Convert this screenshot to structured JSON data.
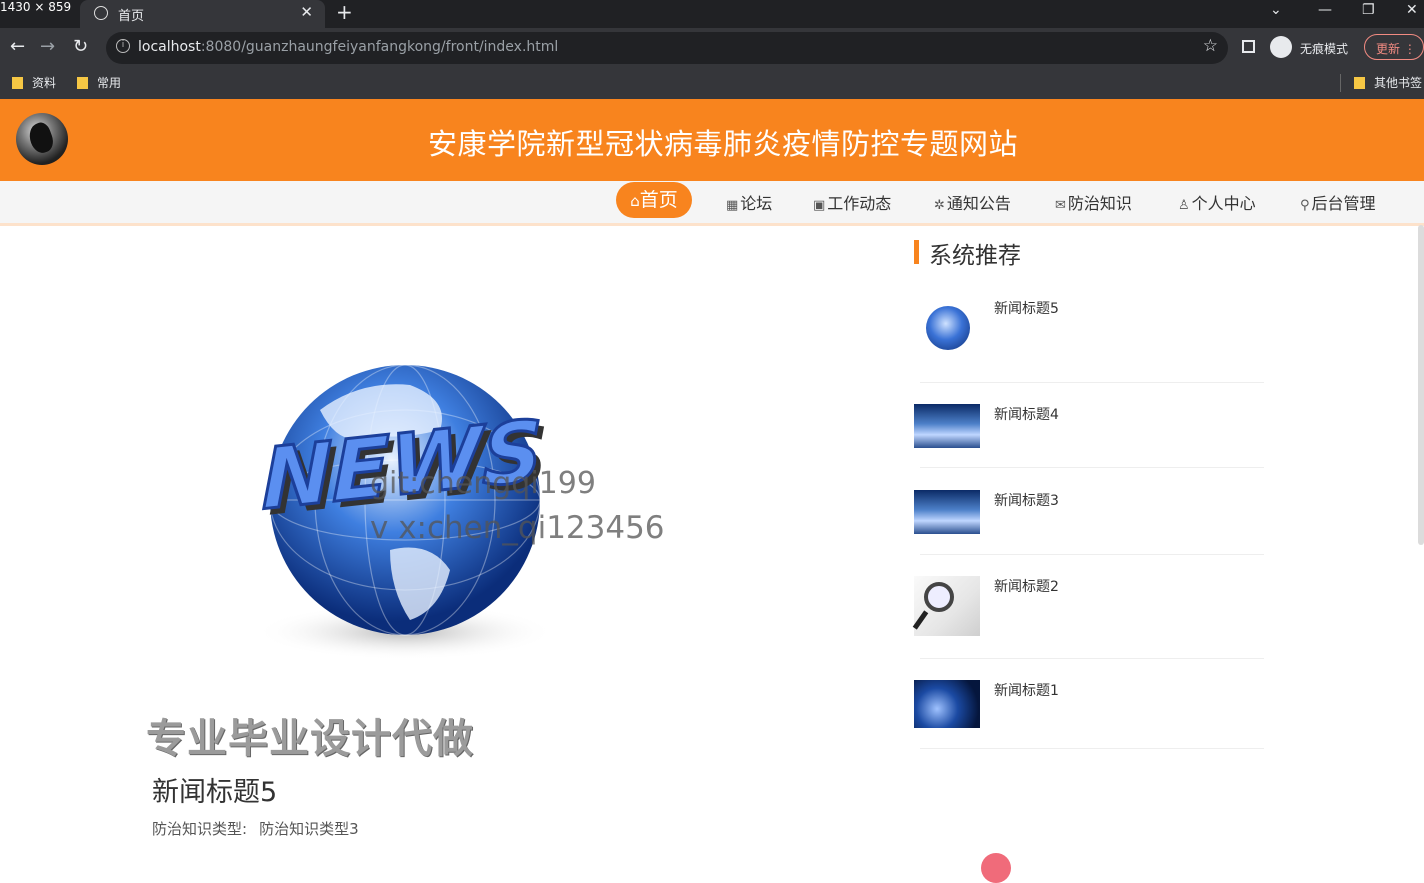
{
  "overlay": {
    "dimensions_text": "1430 × 859"
  },
  "browser": {
    "tab_title": "首页",
    "new_tab": "+",
    "url_host": "localhost",
    "url_rest": ":8080/guanzhaungfeiyanfangkong/front/index.html",
    "incognito_label": "无痕模式",
    "update_label": "更新",
    "bookmarks": [
      "资料",
      "常用"
    ],
    "other_bookmarks": "其他书签"
  },
  "site": {
    "title": "安康学院新型冠状病毒肺炎疫情防控专题网站"
  },
  "nav": {
    "items": [
      {
        "icon": "home-icon",
        "label": "首页",
        "active": true
      },
      {
        "icon": "grid-icon",
        "label": "论坛"
      },
      {
        "icon": "apps-icon",
        "label": "工作动态"
      },
      {
        "icon": "notice-icon",
        "label": "通知公告"
      },
      {
        "icon": "mail-icon",
        "label": "防治知识"
      },
      {
        "icon": "user-icon",
        "label": "个人中心"
      },
      {
        "icon": "link-icon",
        "label": "后台管理"
      }
    ]
  },
  "main": {
    "watermark_line1": "git:chengqi199",
    "watermark_line2": "v x:chen_qi123456",
    "promo_text": "专业毕业设计代做",
    "news_title": "新闻标题5",
    "type_label": "防治知识类型:",
    "type_value": "防治知识类型3"
  },
  "sidebar": {
    "title": "系统推荐",
    "items": [
      {
        "label": "新闻标题5",
        "thumb": "globe-news"
      },
      {
        "label": "新闻标题4",
        "thumb": "stage-spotlight"
      },
      {
        "label": "新闻标题3",
        "thumb": "stage-spotlight"
      },
      {
        "label": "新闻标题2",
        "thumb": "magnifier-paper"
      },
      {
        "label": "新闻标题1",
        "thumb": "blue-earth"
      }
    ]
  },
  "colors": {
    "brand_orange": "#f8841e",
    "browser_dark": "#35363a"
  }
}
